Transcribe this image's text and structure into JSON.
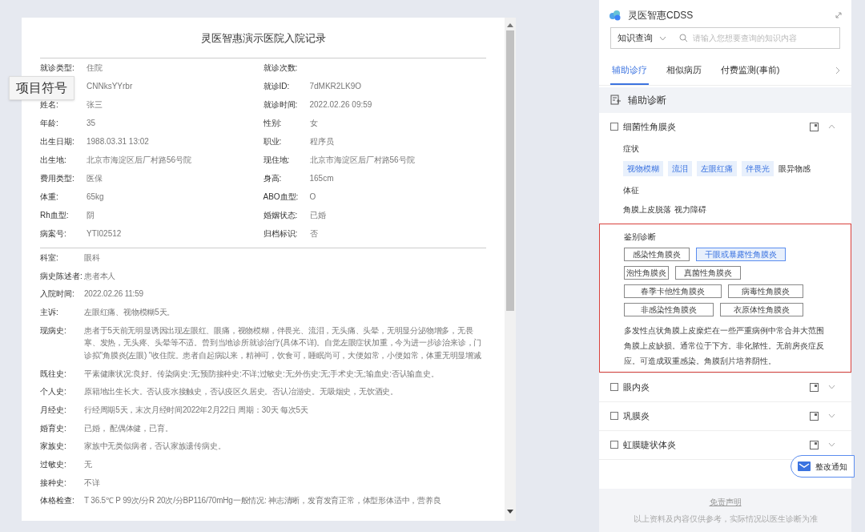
{
  "record": {
    "title": "灵医智惠演示医院入院记录",
    "header_fields": [
      {
        "label": "就诊类型:",
        "value": "住院"
      },
      {
        "label": "就诊次数:"
      },
      {
        "value": "CNNksYYrbr"
      },
      {
        "label": "就诊ID:",
        "value": "7dMKR2LK9O"
      },
      {
        "label": "姓名:",
        "value": "张三"
      },
      {
        "label": "就诊时间:",
        "value": "2022.02.26 09:59"
      },
      {
        "label": "年龄:",
        "value": "35"
      },
      {
        "label": "性别:",
        "value": "女"
      },
      {
        "label": "出生日期:",
        "value": "1988.03.31 13:02"
      },
      {
        "label": "职业:",
        "value": "程序员"
      },
      {
        "label": "出生地:",
        "value": "北京市海淀区后厂村路56号院"
      },
      {
        "label": "现住地:",
        "value": "北京市海淀区后厂村路56号院"
      },
      {
        "label": "费用类型:",
        "value": "医保"
      },
      {
        "label": "身高:",
        "value": "165cm"
      },
      {
        "label": "体重:",
        "value": "65kg"
      },
      {
        "label": "ABO血型:",
        "value": "O"
      },
      {
        "label": "Rh血型:",
        "value": "阴"
      },
      {
        "label": "婚姻状态:",
        "value": "已婚"
      },
      {
        "label": "病案号:",
        "value": "YTI02512"
      },
      {
        "label": "归档标识:",
        "value": "否"
      }
    ],
    "fields": [
      {
        "label": "科室:",
        "value": "眼科"
      },
      {
        "label": "病史陈述者:",
        "value": "患者本人"
      },
      {
        "label": "入院时间:",
        "value": "2022.02.26 11:59"
      },
      {
        "label": "主诉:",
        "value": "左眼红痛、视物模糊5天。"
      },
      {
        "label": "现病史:",
        "value": "患者于5天前无明显诱因出现左眼红、眼痛，视物模糊，伴畏光、流泪，无头痛、头晕，无明显分泌物增多，无畏寒、发热，无头疼、头晕等不适。曾到当地诊所就诊治疗(具体不详)。自觉左眼症状加重，今为进一步诊治来诊，门诊拟\"角膜炎(左眼) \"收住院。患者自起病以来，精神可，饮食可，睡眠尚可，大便如常，小便如常，体重无明显增减"
      },
      {
        "label": "既往史:",
        "value": "平素健康状况:良好。传染病史:无;预防接种史:不详;过敏史:无;外伤史:无;手术史:无;输血史:否认输血史。"
      },
      {
        "label": "个人史:",
        "value": "原籍地出生长大。否认疫水接触史，否认疫区久居史。否认冶游史。无吸烟史，无饮酒史。"
      },
      {
        "label": "月经史:",
        "value": "行经周期5天，末次月经时间2022年2月22日 周期：30天 每次5天"
      },
      {
        "label": "婚育史:",
        "value": "已婚， 配偶体健，已育。"
      },
      {
        "label": "家族史:",
        "value": "家族中无类似病者，否认家族遗传病史。"
      },
      {
        "label": "过敏史:",
        "value": "无"
      },
      {
        "label": "接种史:",
        "value": "不详"
      },
      {
        "label": "体格检查:",
        "value": "T 36.5℃ P 99次/分R 20次/分BP116/70mHg一般情况: 神志清晰，发育发育正常，体型形体适中，营养良"
      }
    ],
    "tooltip": "项目符号"
  },
  "cdss": {
    "app_title": "灵医智惠CDSS",
    "search": {
      "category": "知识查询",
      "placeholder": "请输入您想要查询的知识内容"
    },
    "tabs": [
      {
        "label": "辅助诊疗",
        "selected": true
      },
      {
        "label": "相似病历",
        "selected": false
      },
      {
        "label": "付费监测(事前)",
        "selected": false
      }
    ],
    "section_title": "辅助诊断",
    "diagnoses": [
      {
        "name": "细菌性角膜炎",
        "checked": false,
        "expanded": true,
        "symptoms_heading": "症状",
        "symptoms": [
          {
            "label": "视物模糊",
            "matched": true
          },
          {
            "label": "流泪",
            "matched": true
          },
          {
            "label": "左眼红痛",
            "matched": true
          },
          {
            "label": "伴畏光",
            "matched": true
          },
          {
            "label": "眼异物感",
            "matched": false
          }
        ],
        "signs_heading": "体征",
        "signs": [
          "角膜上皮脱落",
          "视力障碍"
        ],
        "differential": {
          "heading": "鉴别诊断",
          "highlighted": true,
          "rows": [
            [
              {
                "label": "感染性角膜炎",
                "selected": false
              },
              {
                "label": "干眼或暴露性角膜炎",
                "selected": true
              }
            ],
            [
              {
                "label": "泡性角膜炎",
                "selected": false
              },
              {
                "label": "真菌性角膜炎",
                "selected": false
              }
            ],
            [
              {
                "label": "春季卡他性角膜炎",
                "selected": false
              },
              {
                "label": "病毒性角膜炎",
                "selected": false
              }
            ],
            [
              {
                "label": "非感染性角膜炎",
                "selected": false
              },
              {
                "label": "衣原体性角膜炎",
                "selected": false
              }
            ]
          ],
          "description": "多发性点状角膜上皮糜烂在一些严重病例中常合并大范围角膜上皮缺损。通常位于下方。非化脓性。无前房炎症反应。可造成双重感染。角膜刮片培养阴性。"
        }
      },
      {
        "name": "眼内炎",
        "checked": false,
        "expanded": false
      },
      {
        "name": "巩膜炎",
        "checked": false,
        "expanded": false
      },
      {
        "name": "虹膜睫状体炎",
        "checked": false,
        "expanded": false
      }
    ],
    "notice_button": "整改通知",
    "disclaimer_link": "免责声明",
    "disclaimer_note": "以上资料及内容仅供参考，实际情况以医生诊断为准"
  }
}
